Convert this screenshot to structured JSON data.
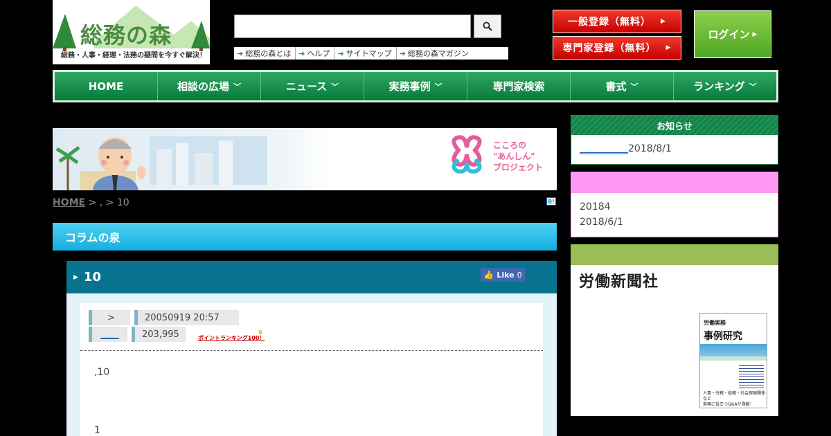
{
  "header": {
    "logo_text": "総務の森",
    "logo_tagline": "総務・人事・経理・法務の疑問を今すぐ解決！",
    "search": {
      "value": "",
      "placeholder": ""
    },
    "subnav": [
      "総務の森とは",
      "ヘルプ",
      "サイトマップ",
      "総務の森マガジン"
    ],
    "register_general": "一般登録（無料）",
    "register_expert": "専門家登録（無料）",
    "login": "ログイン"
  },
  "nav": {
    "items": [
      {
        "label": "HOME",
        "has_menu": false
      },
      {
        "label": "相談の広場",
        "has_menu": true
      },
      {
        "label": "ニュース",
        "has_menu": true
      },
      {
        "label": "実務事例",
        "has_menu": true
      },
      {
        "label": "専門家検索",
        "has_menu": false
      },
      {
        "label": "書式",
        "has_menu": true
      },
      {
        "label": "ランキング",
        "has_menu": true
      }
    ]
  },
  "banner": {
    "line1": "こころの",
    "line2": "\"あんしん\"",
    "line3": "プロジェクト"
  },
  "breadcrumb": {
    "home": "HOME",
    "rest": " > , > 10"
  },
  "hatena_label": "B!",
  "column": {
    "title": "コラムの泉"
  },
  "article": {
    "title": "10",
    "fb_like": "Like",
    "fb_count": "0",
    "meta": {
      "label_1": ">",
      "datetime": "20050919 20:57",
      "label_2": "____",
      "points": "203,995",
      "ranking_link": "ポイントランキング100！"
    },
    "body_1": ",10",
    "body_2": "1"
  },
  "sidebar": {
    "notice": {
      "title": "お知らせ",
      "link_text": "__________",
      "date": "2018/8/1"
    },
    "pink": {
      "line_1": "20184",
      "line_2": "2018/6/1"
    },
    "publisher": {
      "name": "労働新聞社",
      "book_sub": "労働実務",
      "book_title": "事例研究",
      "book_foot_1": "人事・労務・総務・社会保険関係など",
      "book_foot_2": "実務に役立つQ&Aが満載！"
    }
  },
  "colors": {
    "nav_green": "#077a3c",
    "register_red": "#c40000",
    "login_green": "#4da522",
    "column_blue": "#15aee0",
    "article_teal": "#08738e",
    "pink": "#ff99f5",
    "publisher_green": "#9bbd57"
  },
  "icons": {
    "search": "search-icon",
    "arrow": "arrow-right-icon",
    "chevron": "chevron-down-icon",
    "like": "thumbs-up-icon",
    "crown": "crown-icon"
  }
}
